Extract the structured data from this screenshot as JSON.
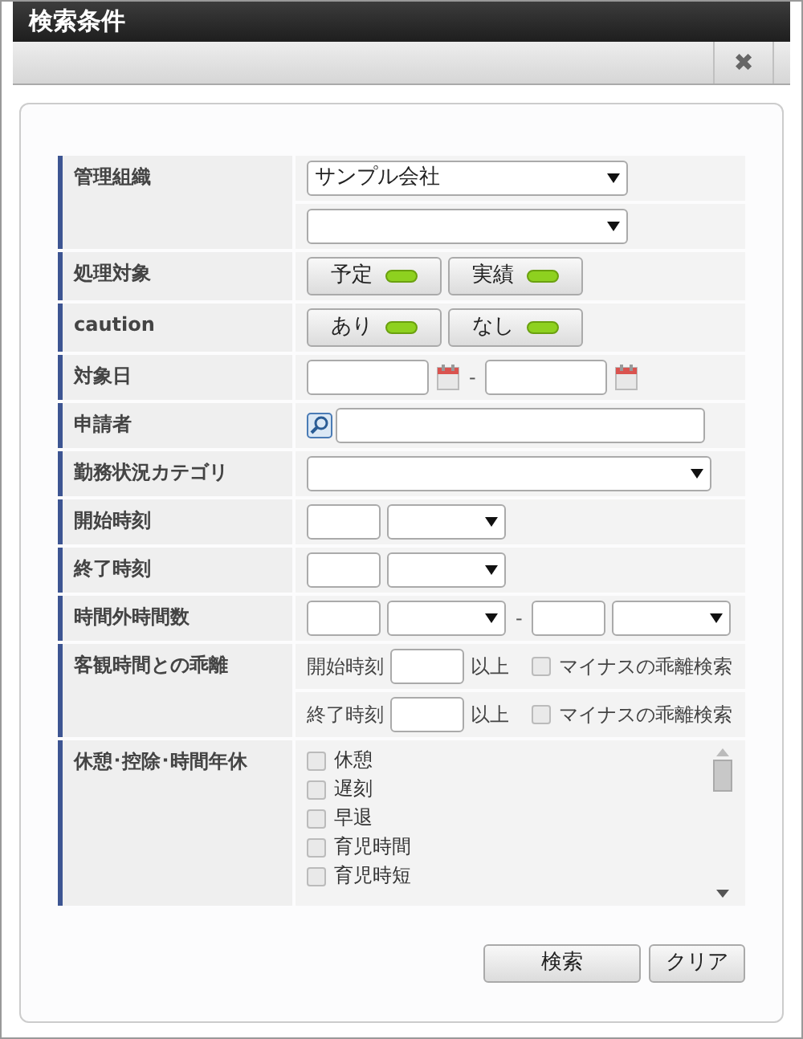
{
  "window": {
    "title": "検索条件",
    "close": "✖"
  },
  "rows": [
    {
      "label": "管理組織",
      "lines": [
        [
          {
            "kind": "dropdown",
            "value": "サンプル会社"
          }
        ],
        [
          {
            "kind": "dropdown"
          }
        ]
      ]
    },
    {
      "label": "処理対象",
      "lines": [
        [
          {
            "kind": "toggle",
            "label": "予定",
            "on": true
          },
          {
            "kind": "toggle",
            "label": "実績",
            "on": true
          }
        ]
      ]
    },
    {
      "label": "caution",
      "lines": [
        [
          {
            "kind": "toggle",
            "label": "あり",
            "on": true
          },
          {
            "kind": "toggle",
            "label": "なし",
            "on": true
          }
        ]
      ]
    },
    {
      "label": "対象日",
      "lines": [
        [
          {
            "kind": "date"
          },
          {
            "kind": "dash",
            "text": "-"
          },
          {
            "kind": "date"
          }
        ]
      ]
    },
    {
      "label": "申請者",
      "lines": [
        [
          {
            "kind": "finder"
          }
        ]
      ]
    },
    {
      "label": "勤務状況カテゴリ",
      "lines": [
        [
          {
            "kind": "longselect"
          }
        ]
      ]
    },
    {
      "label": "開始時刻",
      "lines": [
        [
          {
            "kind": "box"
          },
          {
            "kind": "picker"
          }
        ]
      ]
    },
    {
      "label": "終了時刻",
      "lines": [
        [
          {
            "kind": "box"
          },
          {
            "kind": "picker"
          }
        ]
      ]
    },
    {
      "label": "時間外時間数",
      "lines": [
        [
          {
            "kind": "box"
          },
          {
            "kind": "picker"
          },
          {
            "kind": "dash",
            "text": "-"
          },
          {
            "kind": "box"
          },
          {
            "kind": "picker"
          }
        ]
      ]
    },
    {
      "label": "客観時間との乖離",
      "lines": [
        [
          {
            "kind": "caption",
            "text": "開始時刻"
          },
          {
            "kind": "box"
          },
          {
            "kind": "caption",
            "text": "以上"
          },
          {
            "kind": "checkbox",
            "label": "マイナスの乖離検索",
            "checked": false
          }
        ],
        [
          {
            "kind": "caption",
            "text": "終了時刻"
          },
          {
            "kind": "box"
          },
          {
            "kind": "caption",
            "text": "以上"
          },
          {
            "kind": "checkbox",
            "label": "マイナスの乖離検索",
            "checked": false
          }
        ]
      ]
    },
    {
      "label": "休憩･控除･時間年休",
      "lines": [
        [
          {
            "kind": "checklist",
            "items": [
              {
                "label": "休憩",
                "checked": false
              },
              {
                "label": "遅刻",
                "checked": false
              },
              {
                "label": "早退",
                "checked": false
              },
              {
                "label": "育児時間",
                "checked": false
              },
              {
                "label": "育児時短",
                "checked": false
              }
            ]
          }
        ]
      ]
    }
  ],
  "buttons": [
    "検索",
    "クリア"
  ]
}
